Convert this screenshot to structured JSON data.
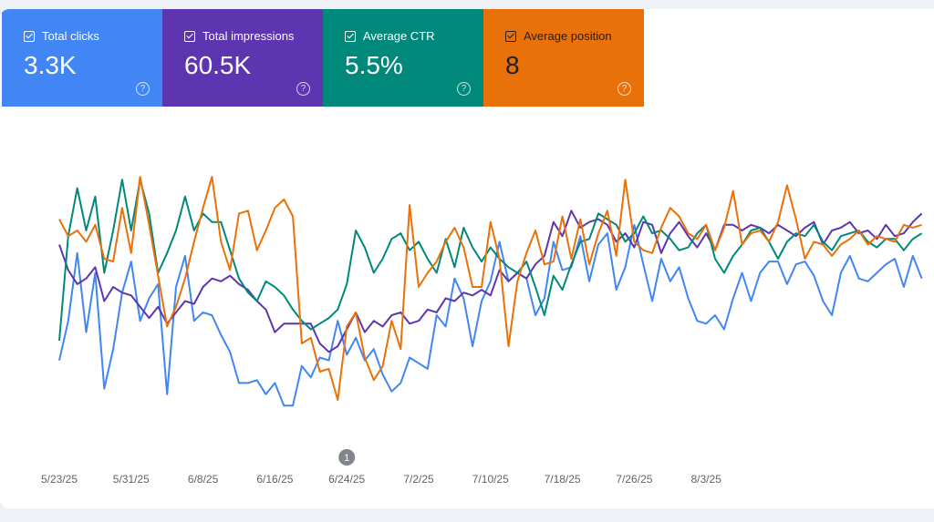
{
  "metrics": [
    {
      "label": "Total clicks",
      "value": "3.3K",
      "color": "#4285f4",
      "help_icon": "help-circle-icon"
    },
    {
      "label": "Total impressions",
      "value": "60.5K",
      "color": "#5e35b1",
      "help_icon": "help-circle-icon"
    },
    {
      "label": "Average CTR",
      "value": "5.5%",
      "color": "#00897b",
      "help_icon": "help-circle-icon"
    },
    {
      "label": "Average position",
      "value": "8",
      "color": "#e8710a",
      "help_icon": "help-circle-icon"
    }
  ],
  "annotation": {
    "label": "1",
    "date": "6/18/25"
  },
  "chart_data": {
    "type": "line",
    "x_tick_labels": [
      "5/23/25",
      "5/31/25",
      "6/8/25",
      "6/16/25",
      "6/24/25",
      "7/2/25",
      "7/10/25",
      "7/18/25",
      "7/26/25",
      "8/3/25"
    ],
    "x_start": "5/23/25",
    "grid": false,
    "legend": "none",
    "series": [
      {
        "name": "Total clicks",
        "color": "#4285f4",
        "values": [
          0.24,
          0.38,
          0.62,
          0.34,
          0.55,
          0.14,
          0.28,
          0.48,
          0.59,
          0.38,
          0.46,
          0.51,
          0.12,
          0.5,
          0.61,
          0.38,
          0.41,
          0.4,
          0.33,
          0.27,
          0.16,
          0.16,
          0.17,
          0.12,
          0.16,
          0.08,
          0.08,
          0.22,
          0.18,
          0.25,
          0.24,
          0.38,
          0.26,
          0.32,
          0.24,
          0.28,
          0.19,
          0.13,
          0.16,
          0.25,
          0.23,
          0.21,
          0.4,
          0.36,
          0.53,
          0.46,
          0.29,
          0.45,
          0.52,
          0.66,
          0.52,
          0.55,
          0.53,
          0.4,
          0.46,
          0.66,
          0.56,
          0.57,
          0.68,
          0.52,
          0.65,
          0.69,
          0.49,
          0.57,
          0.72,
          0.58,
          0.45,
          0.6,
          0.52,
          0.57,
          0.46,
          0.38,
          0.37,
          0.4,
          0.35,
          0.46,
          0.55,
          0.45,
          0.55,
          0.59,
          0.59,
          0.51,
          0.58,
          0.59,
          0.54,
          0.45,
          0.4,
          0.55,
          0.61,
          0.53,
          0.52,
          0.55,
          0.58,
          0.6,
          0.5,
          0.61,
          0.53
        ]
      },
      {
        "name": "Total impressions",
        "color": "#5e35b1",
        "values": [
          0.65,
          0.56,
          0.51,
          0.53,
          0.57,
          0.45,
          0.5,
          0.48,
          0.47,
          0.43,
          0.39,
          0.43,
          0.37,
          0.41,
          0.45,
          0.44,
          0.5,
          0.53,
          0.52,
          0.54,
          0.51,
          0.49,
          0.45,
          0.42,
          0.34,
          0.37,
          0.37,
          0.37,
          0.37,
          0.3,
          0.27,
          0.29,
          0.35,
          0.41,
          0.34,
          0.38,
          0.36,
          0.4,
          0.41,
          0.37,
          0.38,
          0.42,
          0.41,
          0.46,
          0.45,
          0.48,
          0.47,
          0.49,
          0.47,
          0.56,
          0.52,
          0.55,
          0.53,
          0.58,
          0.61,
          0.73,
          0.68,
          0.77,
          0.71,
          0.73,
          0.74,
          0.72,
          0.66,
          0.69,
          0.64,
          0.73,
          0.72,
          0.62,
          0.69,
          0.73,
          0.68,
          0.64,
          0.69,
          0.63,
          0.72,
          0.72,
          0.7,
          0.72,
          0.71,
          0.69,
          0.72,
          0.7,
          0.68,
          0.71,
          0.73,
          0.65,
          0.7,
          0.71,
          0.73,
          0.69,
          0.7,
          0.67,
          0.72,
          0.68,
          0.69,
          0.73,
          0.76
        ]
      },
      {
        "name": "Average CTR",
        "color": "#00897b",
        "values": [
          0.31,
          0.68,
          0.85,
          0.7,
          0.82,
          0.55,
          0.7,
          0.88,
          0.7,
          0.88,
          0.76,
          0.55,
          0.62,
          0.7,
          0.82,
          0.7,
          0.76,
          0.73,
          0.73,
          0.63,
          0.53,
          0.48,
          0.45,
          0.52,
          0.5,
          0.47,
          0.42,
          0.38,
          0.35,
          0.37,
          0.39,
          0.42,
          0.51,
          0.7,
          0.64,
          0.55,
          0.6,
          0.67,
          0.69,
          0.63,
          0.66,
          0.6,
          0.55,
          0.67,
          0.57,
          0.71,
          0.64,
          0.59,
          0.64,
          0.6,
          0.57,
          0.55,
          0.59,
          0.5,
          0.4,
          0.54,
          0.49,
          0.58,
          0.66,
          0.67,
          0.76,
          0.74,
          0.72,
          0.66,
          0.69,
          0.75,
          0.69,
          0.7,
          0.67,
          0.63,
          0.64,
          0.69,
          0.72,
          0.6,
          0.55,
          0.61,
          0.65,
          0.7,
          0.71,
          0.66,
          0.6,
          0.66,
          0.69,
          0.68,
          0.72,
          0.66,
          0.63,
          0.68,
          0.69,
          0.7,
          0.66,
          0.64,
          0.67,
          0.67,
          0.63,
          0.67,
          0.69
        ]
      },
      {
        "name": "Average position",
        "color": "#e8710a",
        "values": [
          0.74,
          0.68,
          0.7,
          0.66,
          0.72,
          0.6,
          0.59,
          0.78,
          0.62,
          0.89,
          0.72,
          0.54,
          0.36,
          0.43,
          0.53,
          0.66,
          0.78,
          0.89,
          0.66,
          0.56,
          0.76,
          0.77,
          0.63,
          0.7,
          0.78,
          0.81,
          0.75,
          0.3,
          0.32,
          0.2,
          0.21,
          0.1,
          0.36,
          0.41,
          0.25,
          0.17,
          0.22,
          0.38,
          0.28,
          0.79,
          0.5,
          0.55,
          0.59,
          0.66,
          0.71,
          0.64,
          0.5,
          0.5,
          0.73,
          0.6,
          0.29,
          0.52,
          0.62,
          0.7,
          0.58,
          0.59,
          0.75,
          0.6,
          0.74,
          0.58,
          0.69,
          0.77,
          0.61,
          0.88,
          0.66,
          0.63,
          0.62,
          0.71,
          0.78,
          0.75,
          0.69,
          0.67,
          0.72,
          0.63,
          0.71,
          0.84,
          0.65,
          0.69,
          0.7,
          0.66,
          0.73,
          0.86,
          0.74,
          0.6,
          0.66,
          0.65,
          0.61,
          0.65,
          0.67,
          0.7,
          0.65,
          0.68,
          0.67,
          0.66,
          0.72,
          0.71,
          0.72
        ]
      }
    ]
  }
}
